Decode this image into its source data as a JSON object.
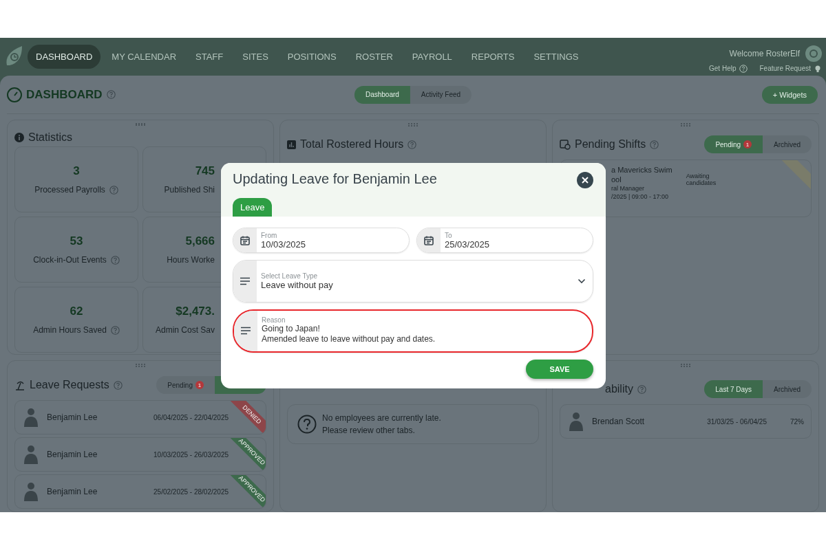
{
  "nav": {
    "items": [
      {
        "label": "DASHBOARD",
        "selected": true
      },
      {
        "label": "MY CALENDAR",
        "selected": false
      },
      {
        "label": "STAFF",
        "selected": false
      },
      {
        "label": "SITES",
        "selected": false
      },
      {
        "label": "POSITIONS",
        "selected": false
      },
      {
        "label": "ROSTER",
        "selected": false
      },
      {
        "label": "PAYROLL",
        "selected": false
      },
      {
        "label": "REPORTS",
        "selected": false
      },
      {
        "label": "SETTINGS",
        "selected": false
      }
    ],
    "welcome": "Welcome RosterElf",
    "links": [
      {
        "kind": "help",
        "label": "Get Help"
      },
      {
        "kind": "idea",
        "label": "Feature Request"
      }
    ]
  },
  "page": {
    "title": "DASHBOARD",
    "tabs": [
      {
        "label": "Dashboard",
        "selected": true
      },
      {
        "label": "Activity Feed",
        "selected": false
      }
    ],
    "widgets_button": "+ Widgets"
  },
  "statistics": {
    "title": "Statistics",
    "tiles": [
      {
        "value": "3",
        "label": "Processed Payrolls",
        "help": true
      },
      {
        "value": "745",
        "label": "Published Shi",
        "help": false
      },
      {
        "value": "53",
        "label": "Clock-in-Out Events",
        "help": true
      },
      {
        "value": "5,666",
        "label": "Hours Worke",
        "help": false
      },
      {
        "value": "62",
        "label": "Admin Hours Saved",
        "help": true
      },
      {
        "value": "$2,473.",
        "label": "Admin Cost Sav",
        "help": false
      }
    ]
  },
  "rostered_hours": {
    "title": "Total Rostered Hours"
  },
  "late": {
    "lines": [
      "No employees are currently late.",
      "Please review other tabs."
    ]
  },
  "pending_shifts": {
    "title": "Pending Shifts",
    "tabs": [
      {
        "label": "Pending",
        "badge": "1",
        "selected": true
      },
      {
        "label": "Archived",
        "selected": false
      }
    ],
    "shift": {
      "lines": [
        "a Mavericks Swim",
        "ool",
        "ral Manager",
        "/2025 | 09:00 - 17:00"
      ],
      "status": "Awaiting candidates"
    }
  },
  "leave_requests": {
    "title": "Leave Requests",
    "tabs": [
      {
        "label": "Pending",
        "badge": "1",
        "selected": false
      },
      {
        "selected": true
      }
    ],
    "rows": [
      {
        "name": "Benjamin Lee",
        "dates": "06/04/2025 - 22/04/2025",
        "kind": "denied",
        "status": "DENIED"
      },
      {
        "name": "Benjamin Lee",
        "dates": "10/03/2025 - 26/03/2025",
        "kind": "approved",
        "status": "APPROVED"
      },
      {
        "name": "Benjamin Lee",
        "dates": "25/02/2025 - 28/02/2025",
        "kind": "approved",
        "status": "APPROVED"
      }
    ]
  },
  "availability": {
    "title": "ability",
    "tabs": [
      {
        "label": "Last 7 Days",
        "selected": true
      },
      {
        "label": "Archived",
        "selected": false
      }
    ],
    "rows": [
      {
        "name": "Brendan Scott",
        "dates": "31/03/25 - 06/04/25",
        "percent": "72%"
      }
    ]
  },
  "modal": {
    "title": "Updating Leave for Benjamin Lee",
    "tabs": [
      {
        "label": "Leave",
        "selected": true
      }
    ],
    "fields": [
      {
        "kind": "date",
        "label": "From",
        "value": "10/03/2025",
        "highlighted": false
      },
      {
        "kind": "date",
        "label": "To",
        "value": "25/03/2025",
        "highlighted": false
      },
      {
        "kind": "select",
        "label": "Select Leave Type",
        "value": "Leave without pay",
        "highlighted": false
      },
      {
        "kind": "text",
        "label": "Reason",
        "value": "Going to Japan!\nAmended leave to leave without pay and dates.",
        "highlighted": true
      }
    ],
    "save": "SAVE"
  }
}
